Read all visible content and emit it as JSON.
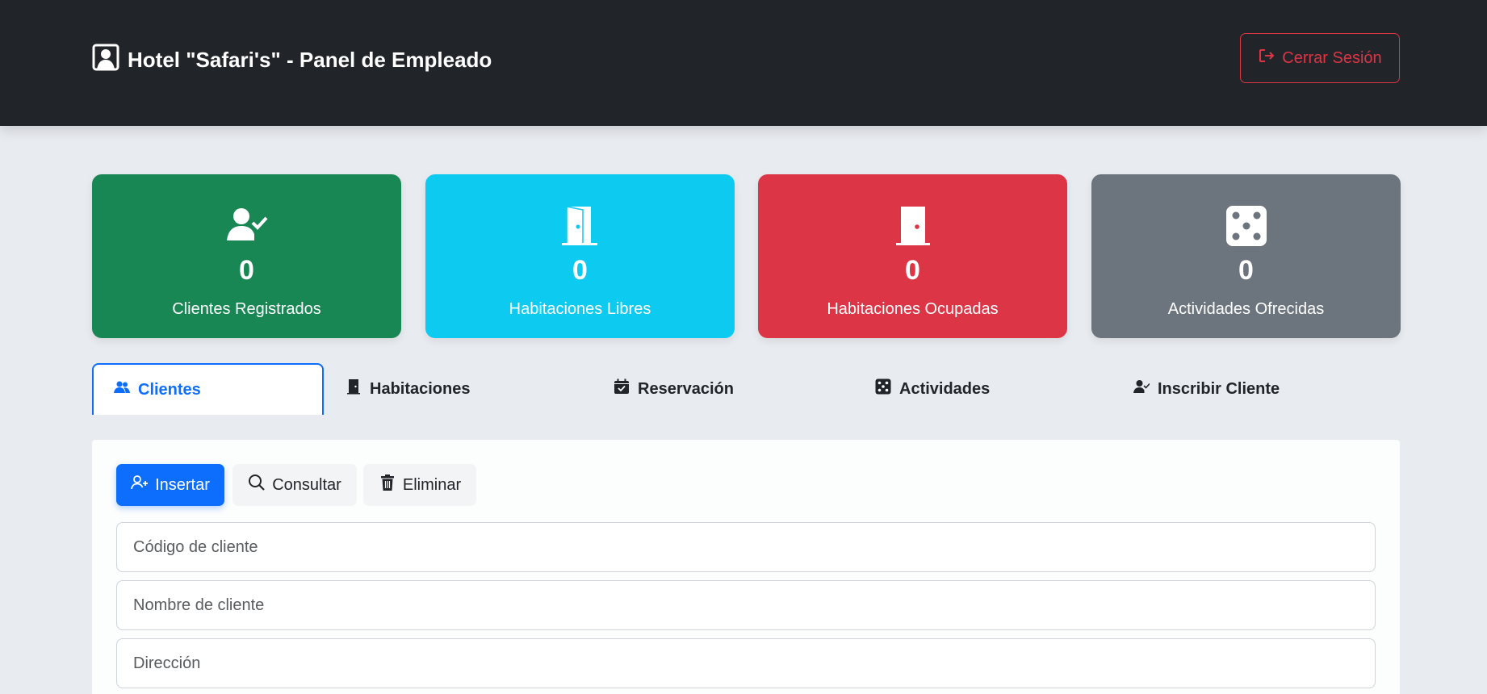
{
  "header": {
    "title": "Hotel \"Safari's\" - Panel de Empleado",
    "logout_label": "Cerrar Sesión"
  },
  "stats": [
    {
      "value": "0",
      "label": "Clientes Registrados",
      "icon": "user-check-icon",
      "color": "#198754"
    },
    {
      "value": "0",
      "label": "Habitaciones Libres",
      "icon": "door-open-icon",
      "color": "#0dcaf0"
    },
    {
      "value": "0",
      "label": "Habitaciones Ocupadas",
      "icon": "door-closed-icon",
      "color": "#dc3545"
    },
    {
      "value": "0",
      "label": "Actividades Ofrecidas",
      "icon": "dice-icon",
      "color": "#6c757d"
    }
  ],
  "tabs": [
    {
      "label": "Clientes",
      "icon": "users-icon",
      "active": true
    },
    {
      "label": "Habitaciones",
      "icon": "door-icon"
    },
    {
      "label": "Reservación",
      "icon": "calendar-check-icon"
    },
    {
      "label": "Actividades",
      "icon": "dice-icon"
    },
    {
      "label": "Inscribir Cliente",
      "icon": "user-check-icon"
    }
  ],
  "actions": {
    "insert_label": "Insertar",
    "consult_label": "Consultar",
    "delete_label": "Eliminar"
  },
  "form": {
    "code_placeholder": "Código de cliente",
    "name_placeholder": "Nombre de cliente",
    "address_placeholder": "Dirección"
  },
  "colors": {
    "primary": "#0d6efd",
    "danger": "#dc3545",
    "dark": "#212529"
  }
}
